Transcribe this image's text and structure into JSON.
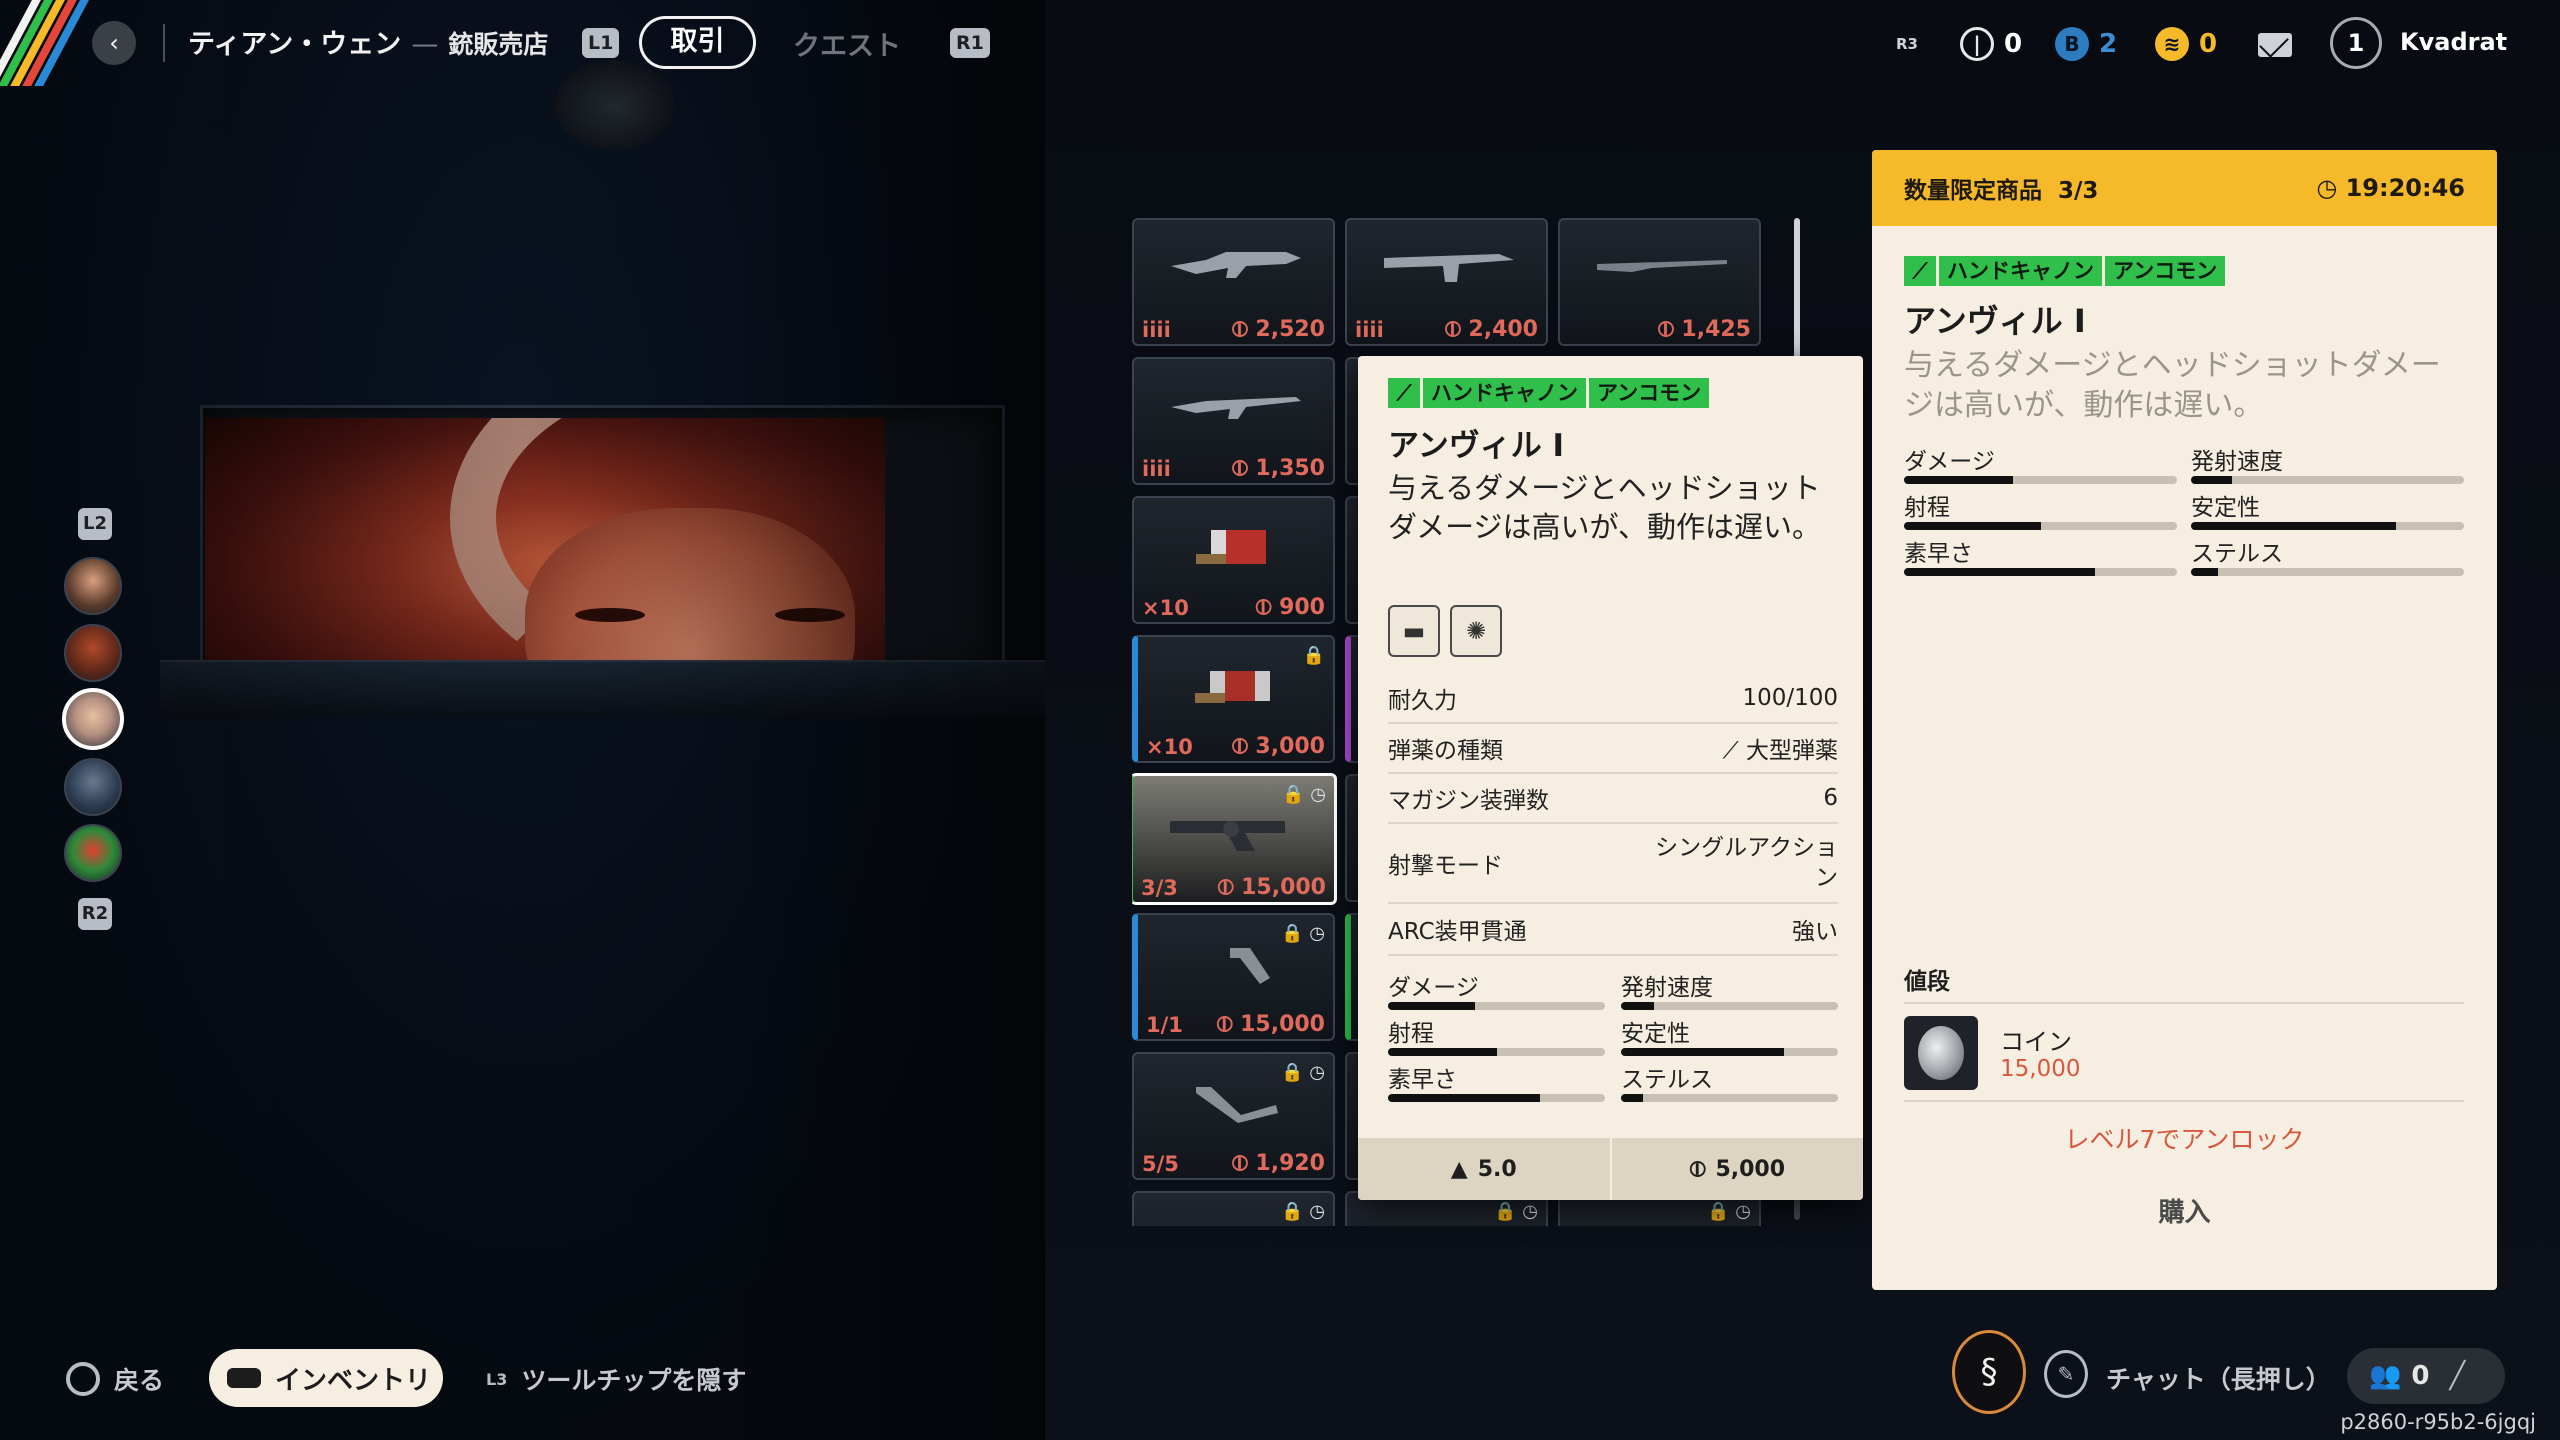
{
  "top_bar": {
    "vendor_name": "ティアン・ウェン",
    "vendor_separator": "—",
    "vendor_type": "銃販売店",
    "key_prev": "L1",
    "tab_active": "取引",
    "tab_inactive": "クエスト",
    "key_next": "R1",
    "key_r3": "R3",
    "currency_coin": "0",
    "currency_blue": "2",
    "currency_gold": "0",
    "player_level": "1",
    "player_name": "Kvadrat"
  },
  "side": {
    "key_up": "L2",
    "key_down": "R2"
  },
  "grid": {
    "cells": [
      {
        "count": "iiii",
        "price": "2,520",
        "locked": false,
        "timed": false
      },
      {
        "count": "iiii",
        "price": "2,400",
        "locked": false,
        "timed": false
      },
      {
        "count": "",
        "price": "1,425",
        "locked": false,
        "timed": false
      },
      {
        "count": "iiii",
        "price": "1,350",
        "locked": false,
        "timed": false
      },
      {
        "count": "×10",
        "price": "900",
        "locked": false,
        "timed": false
      },
      {
        "count": "×10",
        "price": "3,000",
        "locked": true,
        "timed": false
      },
      {
        "count": "3/3",
        "price": "15,000",
        "locked": true,
        "timed": true
      },
      {
        "count": "1/1",
        "price": "15,000",
        "locked": true,
        "timed": true
      },
      {
        "count": "5/5",
        "price": "1,920",
        "locked": true,
        "timed": true
      }
    ],
    "lock_symbol": "🔒",
    "clock_symbol": "◷"
  },
  "tooltip": {
    "tag_type": "ハンドキャノン",
    "tag_rarity": "アンコモン",
    "title": "アンヴィル I",
    "description": "与えるダメージとヘッドショットダメージは高いが、動作は遅い。",
    "stats": [
      {
        "label": "耐久力",
        "value": "100/100"
      },
      {
        "label": "弾薬の種類",
        "value": "大型弾薬"
      },
      {
        "label": "マガジン装弾数",
        "value": "6"
      },
      {
        "label": "射撃モード",
        "value": "シングルアクション"
      },
      {
        "label": "ARC装甲貫通",
        "value": "強い"
      }
    ],
    "bars": [
      {
        "label": "ダメージ",
        "value": 0.4
      },
      {
        "label": "発射速度",
        "value": 0.15
      },
      {
        "label": "射程",
        "value": 0.5
      },
      {
        "label": "安定性",
        "value": 0.75
      },
      {
        "label": "素早さ",
        "value": 0.7
      },
      {
        "label": "ステルス",
        "value": 0.1
      }
    ],
    "weight": "5.0",
    "sell_value": "5,000"
  },
  "panel": {
    "limited_label": "数量限定商品",
    "limited_count": "3/3",
    "timer": "19:20:46",
    "tag_type": "ハンドキャノン",
    "tag_rarity": "アンコモン",
    "title": "アンヴィル I",
    "description": "与えるダメージとヘッドショットダメージは高いが、動作は遅い。",
    "bars": [
      {
        "label": "ダメージ",
        "value": 0.4
      },
      {
        "label": "発射速度",
        "value": 0.15
      },
      {
        "label": "射程",
        "value": 0.5
      },
      {
        "label": "安定性",
        "value": 0.75
      },
      {
        "label": "素早さ",
        "value": 0.7
      },
      {
        "label": "ステルス",
        "value": 0.1
      }
    ],
    "price_label": "値段",
    "currency_name": "コイン",
    "currency_amount": "15,000",
    "unlock_text": "レベル7でアンロック",
    "buy_label": "購入"
  },
  "bottom_bar": {
    "back_label": "戻る",
    "inventory_label": "インベントリ",
    "key_l3": "L3",
    "tooltip_toggle_label": "ツールチップを隠す",
    "chat_label": "チャット（長押し）",
    "party_count": "0",
    "session_id": "p2860-r95b2-6jgqj"
  },
  "colors": {
    "accent_gold": "#f6b92a",
    "rarity_green": "#2fbf4a",
    "price_red": "#e06a5b",
    "panel_bg": "#f6efe1"
  }
}
